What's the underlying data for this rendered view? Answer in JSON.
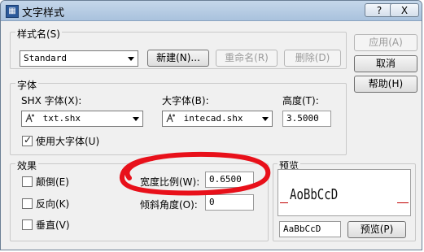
{
  "window": {
    "title": "文字样式",
    "help_button": "?",
    "close_button": "X"
  },
  "style_name": {
    "label": "样式名(S)",
    "value": "Standard",
    "new_button": "新建(N)...",
    "rename_button": "重命名(R)",
    "delete_button": "删除(D)"
  },
  "side_buttons": {
    "apply": "应用(A)",
    "cancel": "取消",
    "help": "帮助(H)"
  },
  "font": {
    "group_label": "字体",
    "shx_label": "SHX 字体(X):",
    "shx_value": "txt.shx",
    "big_label": "大字体(B):",
    "big_value": "intecad.shx",
    "height_label": "高度(T):",
    "height_value": "3.5000",
    "use_big_font_label": "使用大字体(U)",
    "use_big_font_checked": true
  },
  "effects": {
    "group_label": "效果",
    "upside_down": "颠倒(E)",
    "backwards": "反向(K)",
    "vertical": "垂直(V)",
    "width_factor_label": "宽度比例(W):",
    "width_factor_value": "0.6500",
    "oblique_label": "倾斜角度(O):",
    "oblique_value": "0"
  },
  "preview": {
    "group_label": "预览",
    "sample_text": "AoBbCcD",
    "input_value": "AaBbCcD",
    "preview_button": "预览(P)"
  },
  "annotation": {
    "color": "#e8101a"
  },
  "colors": {
    "titlebar": "#b7cce3",
    "window_bg": "#f0f0f0",
    "annotation": "#e8101a"
  }
}
